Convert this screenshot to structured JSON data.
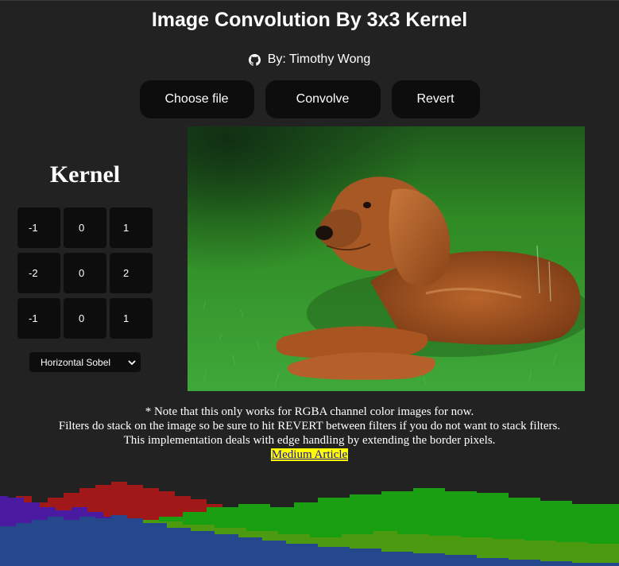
{
  "page": {
    "title": "Image Convolution By 3x3 Kernel",
    "author": "By: Timothy Wong",
    "author_icon": "github-icon"
  },
  "buttons": {
    "choose_file": "Choose file",
    "convolve": "Convolve",
    "revert": "Revert"
  },
  "kernel": {
    "heading": "Kernel",
    "rows": [
      [
        "-1",
        "0",
        "1"
      ],
      [
        "-2",
        "0",
        "2"
      ],
      [
        "-1",
        "0",
        "1"
      ]
    ],
    "selected_filter": "Horizontal Sobel"
  },
  "image": {
    "description_icon": "dog-photo"
  },
  "notes": {
    "line1": "* Note that this only works for RGBA channel color images for now.",
    "line2": "Filters do stack on the image so be sure to hit REVERT between filters if you do not want to stack filters.",
    "line3": "This implementation deals with edge handling by extending the border pixels.",
    "link": "Medium Article"
  },
  "colors": {
    "background": "#222222",
    "button": "#0d0d0d",
    "histogram_red": "#a01818",
    "histogram_purple": "#4a1aa0",
    "histogram_green": "#1a9e12",
    "histogram_olive": "#4c9a10",
    "histogram_blue": "#25488c"
  }
}
